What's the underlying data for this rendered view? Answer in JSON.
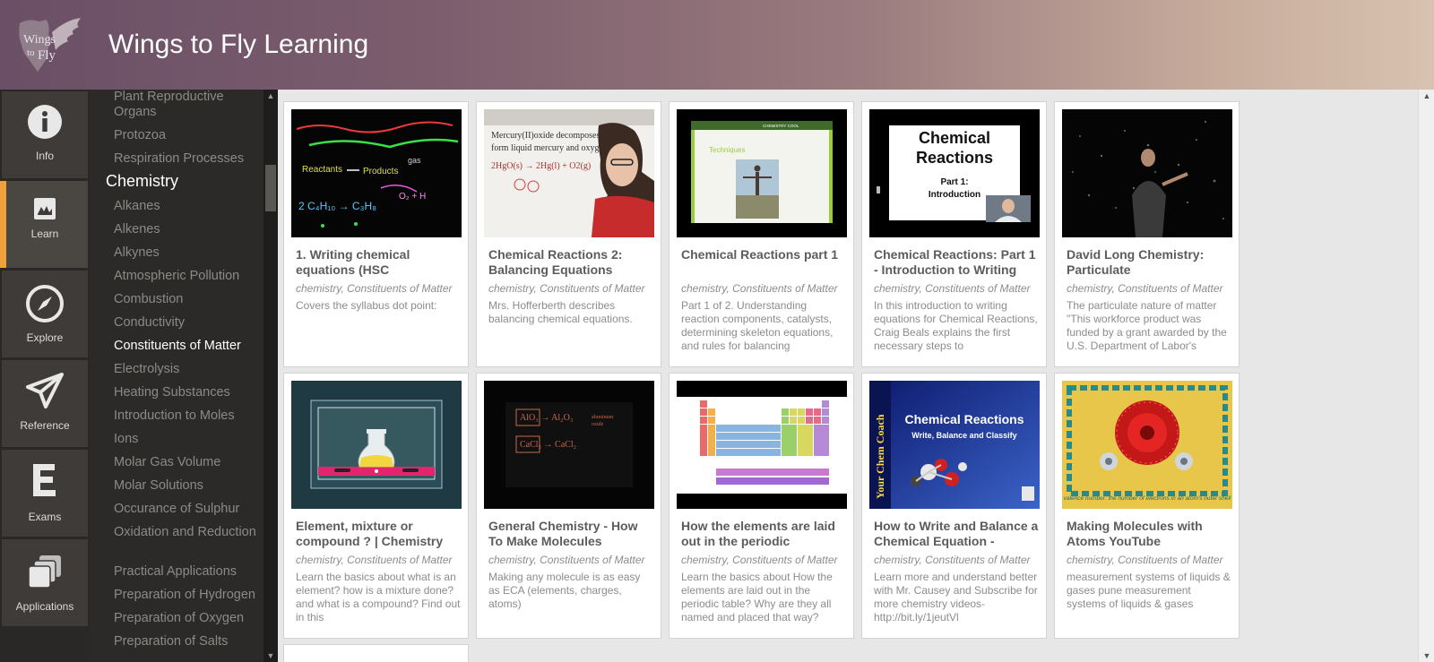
{
  "app": {
    "title": "Wings to Fly Learning",
    "logo_text": "Wings to Fly"
  },
  "nav": [
    {
      "label": "Info",
      "icon": "info-icon"
    },
    {
      "label": "Learn",
      "icon": "learn-icon",
      "active": true
    },
    {
      "label": "Explore",
      "icon": "compass-icon"
    },
    {
      "label": "Reference",
      "icon": "paper-plane-icon"
    },
    {
      "label": "Exams",
      "icon": "exams-icon"
    },
    {
      "label": "Applications",
      "icon": "applications-icon"
    }
  ],
  "topics": {
    "before": [
      "Plant Reproductive Organs",
      "Protozoa",
      "Respiration Processes"
    ],
    "heading": "Chemistry",
    "items": [
      "Alkanes",
      "Alkenes",
      "Alkynes",
      "Atmospheric Pollution",
      "Combustion",
      "Conductivity",
      "Constituents of Matter",
      "Electrolysis",
      "Heating Substances",
      "Introduction to Moles",
      "Ions",
      "Molar Gas Volume",
      "Molar Solutions",
      "Occurance of Sulphur",
      "Oxidation and Reduction",
      "Practical Applications",
      "Preparation of Hydrogen",
      "Preparation of Oxygen",
      "Preparation of Salts"
    ],
    "current": "Constituents of Matter"
  },
  "cards": [
    {
      "title": "1. Writing chemical equations (HSC",
      "tags": "chemistry, Constituents of Matter",
      "desc": "Covers the syllabus dot point:",
      "thumb": "chalkboard"
    },
    {
      "title": "Chemical Reactions 2: Balancing Equations",
      "tags": "chemistry, Constituents of Matter",
      "desc": "Mrs. Hofferberth describes balancing chemical equations.",
      "thumb": "whiteboard"
    },
    {
      "title": "Chemical Reactions part 1",
      "tags": "chemistry, Constituents of Matter",
      "desc": "Part 1 of 2. Understanding reaction components, catalysts, determining skeleton equations, and rules for balancing",
      "thumb": "slide",
      "thumb_text": "Techniques"
    },
    {
      "title": "Chemical Reactions: Part 1 - Introduction to Writing",
      "tags": "chemistry, Constituents of Matter",
      "desc": "In this introduction to writing equations for Chemical Reactions, Craig Beals explains the first necessary steps to",
      "thumb": "title-slide",
      "thumb_title": "Chemical Reactions",
      "thumb_sub": "Part 1: Introduction"
    },
    {
      "title": "David Long Chemistry: Particulate",
      "tags": "chemistry, Constituents of Matter",
      "desc": "The particulate nature of matter \"This workforce product was funded by a grant awarded by the U.S. Department of Labor's",
      "thumb": "particles"
    },
    {
      "title": "Element, mixture or compound ? | Chemistry",
      "tags": "chemistry, Constituents of Matter",
      "desc": "Learn the basics about what is an element? how is a mixture done? and what is a compound? Find out in this",
      "thumb": "flask"
    },
    {
      "title": "General Chemistry - How To Make Molecules",
      "tags": "chemistry, Constituents of Matter",
      "desc": "Making any molecule is as easy as ECA (elements, charges, atoms)",
      "thumb": "blackboard"
    },
    {
      "title": "How the elements are laid out in the periodic",
      "tags": "chemistry, Constituents of Matter",
      "desc": "Learn the basics about How the elements are laid out in the periodic table? Why are they all named and placed that way?",
      "thumb": "periodic"
    },
    {
      "title": "How to Write and Balance a Chemical Equation -",
      "tags": "chemistry, Constituents of Matter",
      "desc": "Learn more and understand better with Mr. Causey and Subscribe for more chemistry videos- http://bit.ly/1jeutVl",
      "thumb": "chem-coach",
      "thumb_side": "Your Chem Coach",
      "thumb_title": "Chemical Reactions",
      "thumb_sub": "Write, Balance and Classify"
    },
    {
      "title": "Making Molecules with Atoms YouTube",
      "tags": "chemistry, Constituents of Matter",
      "desc": "measurement systems of liquids & gases pune measurement systems of liquids & gases",
      "thumb": "atoms",
      "thumb_caption": "valence number: the number of electrons in an atom's outer shell"
    }
  ],
  "colors": {
    "accent": "#f0a23a",
    "sidebar": "#2b2a28",
    "nav": "#2a2826"
  }
}
